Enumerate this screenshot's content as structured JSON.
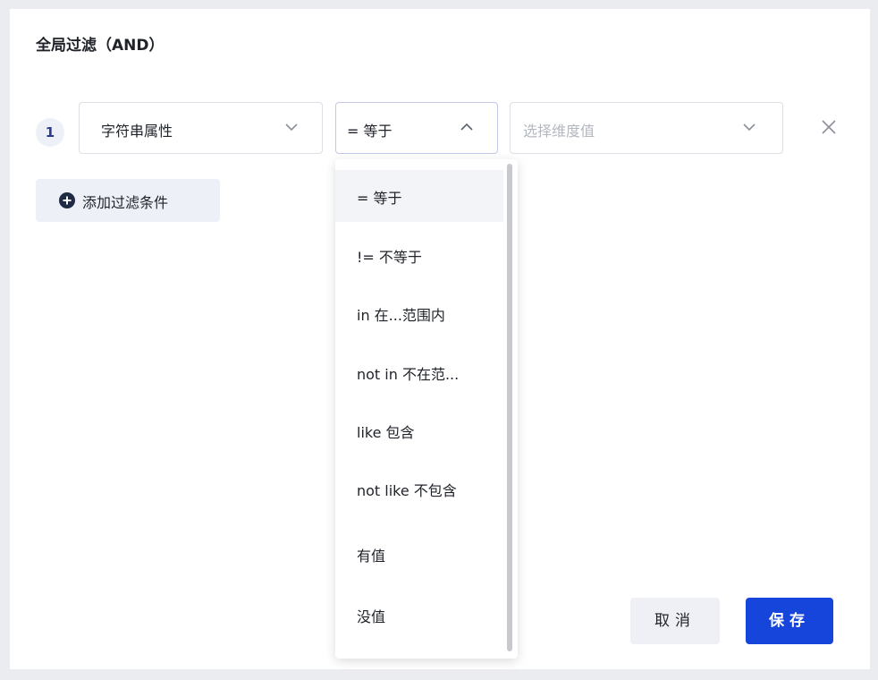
{
  "dialog": {
    "title": "全局过滤（AND）"
  },
  "filter_row": {
    "index": "1",
    "attribute": {
      "value": "字符串属性",
      "icon": "chevron-down-icon"
    },
    "operator": {
      "value": "= 等于",
      "icon": "chevron-up-icon",
      "open": true
    },
    "dimension_value": {
      "placeholder": "选择维度值",
      "icon": "chevron-down-icon"
    },
    "remove_icon": "close-icon"
  },
  "add_filter": {
    "label": "添加过滤条件",
    "icon": "plus-circle-icon"
  },
  "operator_options": [
    {
      "label": "= 等于",
      "selected": true
    },
    {
      "label": "!= 不等于",
      "selected": false
    },
    {
      "label": "in 在...范围内",
      "selected": false
    },
    {
      "label": "not in 不在范...",
      "selected": false
    },
    {
      "label": "like 包含",
      "selected": false
    },
    {
      "label": "not like 不包含",
      "selected": false
    },
    {
      "label": "有值",
      "selected": false
    },
    {
      "label": "没值",
      "selected": false
    }
  ],
  "footer": {
    "cancel_label": "取消",
    "save_label": "保存"
  },
  "colors": {
    "primary": "#1645dc",
    "index_text": "#2d3b8e",
    "add_icon": "#1f2a44"
  }
}
